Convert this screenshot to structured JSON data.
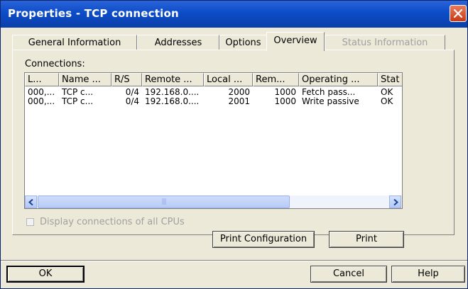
{
  "window": {
    "title": "Properties - TCP connection"
  },
  "tabs": [
    {
      "label": "General Information",
      "state": "normal"
    },
    {
      "label": "Addresses",
      "state": "normal"
    },
    {
      "label": "Options",
      "state": "normal"
    },
    {
      "label": "Overview",
      "state": "active"
    },
    {
      "label": "Status Information",
      "state": "disabled"
    }
  ],
  "connections": {
    "label": "Connections:",
    "columns": [
      "L...",
      "Name ...",
      "R/S",
      "Remote ...",
      "Local ...",
      "Rem...",
      "Operating ...",
      "Stat"
    ],
    "rows": [
      [
        "000,...",
        "TCP c...",
        "0/4",
        "192.168.0....",
        "2000",
        "1000",
        "Fetch pass...",
        "OK"
      ],
      [
        "000,...",
        "TCP c...",
        "0/4",
        "192.168.0....",
        "2001",
        "1000",
        "Write passive",
        "OK"
      ]
    ]
  },
  "scrollbar": {
    "position_fraction": 0.0
  },
  "display_all_cpus": {
    "label": "Display connections of all CPUs",
    "checked": false,
    "enabled": false
  },
  "buttons": {
    "print_config": "Print Configuration",
    "print": "Print",
    "ok": "OK",
    "cancel": "Cancel",
    "help": "Help"
  },
  "icons": {
    "close": "close-x-icon",
    "scroll_left": "arrow-left-icon",
    "scroll_right": "arrow-right-icon"
  },
  "colors": {
    "title_bar": "#0c4cc8",
    "dialog_bg": "#ece9d8",
    "close_button": "#c83a14"
  }
}
